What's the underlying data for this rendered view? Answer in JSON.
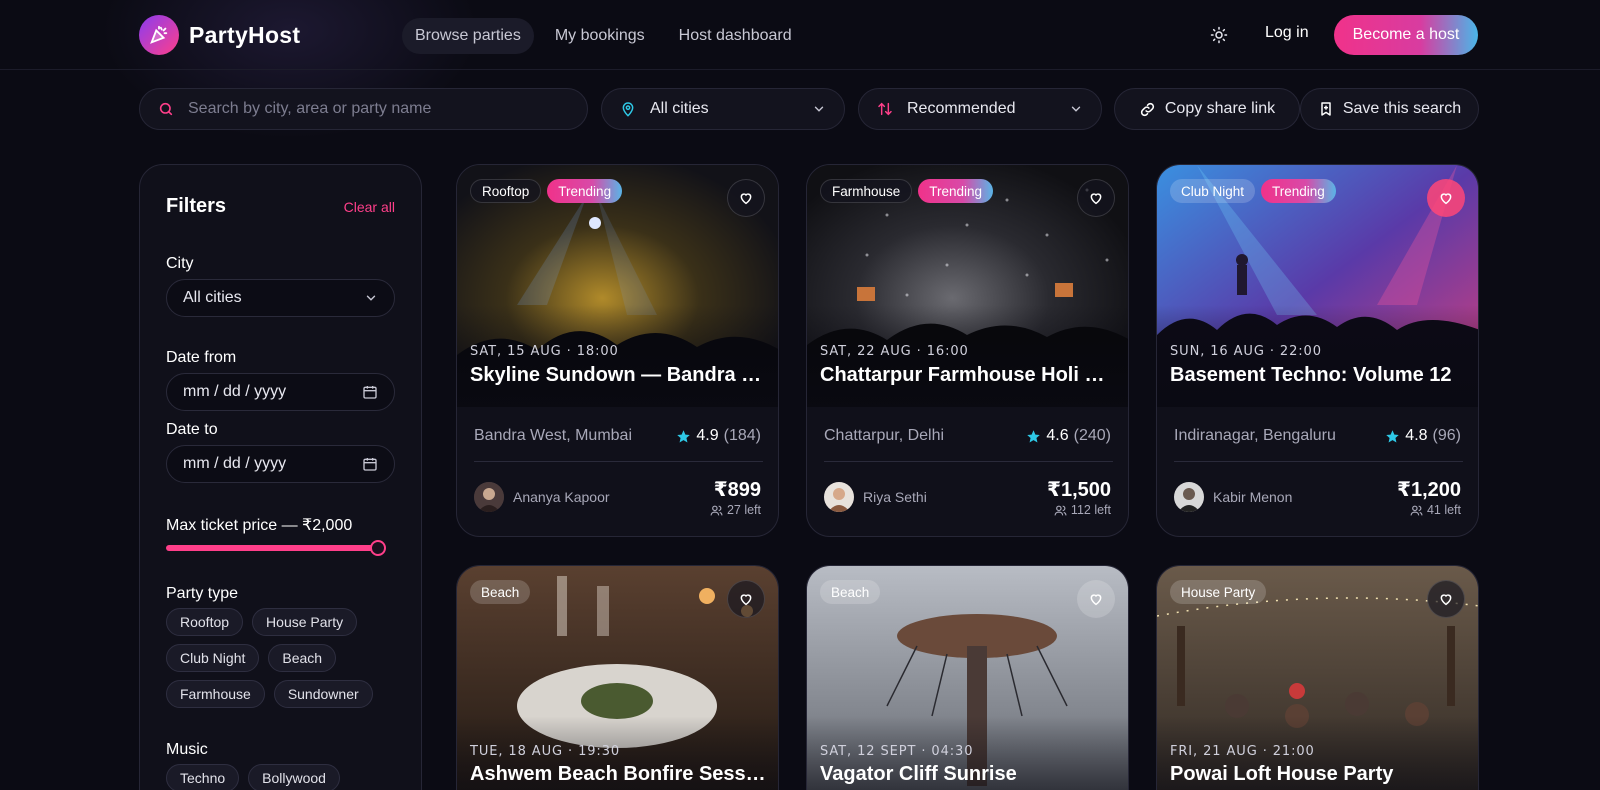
{
  "app": {
    "name": "PartyHost"
  },
  "nav": {
    "items": [
      {
        "label": "Browse parties",
        "active": true
      },
      {
        "label": "My bookings",
        "active": false
      },
      {
        "label": "Host dashboard",
        "active": false
      }
    ],
    "login": "Log in",
    "become_host": "Become a host"
  },
  "search": {
    "placeholder": "Search by city, area or party name"
  },
  "toolbar": {
    "city": "All cities",
    "sort": "Recommended",
    "share": "Copy share link",
    "save": "Save this search"
  },
  "filters": {
    "title": "Filters",
    "clear": "Clear all",
    "city_label": "City",
    "city_value": "All cities",
    "date_from_label": "Date from",
    "date_from_value": "mm / dd / yyyy",
    "date_to_label": "Date to",
    "date_to_value": "mm / dd / yyyy",
    "price_label": "Max ticket price — ₹2,000",
    "price_slider_fraction": 0.96,
    "party_type_label": "Party type",
    "party_types": [
      "Rooftop",
      "House Party",
      "Club Night",
      "Beach",
      "Farmhouse",
      "Sundowner"
    ],
    "music_label": "Music",
    "music": [
      "Techno",
      "Bollywood"
    ]
  },
  "cards": [
    {
      "tags": [
        "Rooftop",
        "Trending"
      ],
      "when": "SAT, 15 AUG · 18:00",
      "name": "Skyline Sundown — Bandra Rooftop",
      "place": "Bandra West, Mumbai",
      "rating": "4.9",
      "reviews": "(184)",
      "host": "Ananya Kapoor",
      "price": "₹899",
      "left": "27 left",
      "favorited": false
    },
    {
      "tags": [
        "Farmhouse",
        "Trending"
      ],
      "when": "SAT, 22 AUG · 16:00",
      "name": "Chattarpur Farmhouse Holi Bash",
      "place": "Chattarpur, Delhi",
      "rating": "4.6",
      "reviews": "(240)",
      "host": "Riya Sethi",
      "price": "₹1,500",
      "left": "112 left",
      "favorited": false
    },
    {
      "tags": [
        "Club Night",
        "Trending"
      ],
      "when": "SUN, 16 AUG · 22:00",
      "name": "Basement Techno: Volume 12",
      "place": "Indiranagar, Bengaluru",
      "rating": "4.8",
      "reviews": "(96)",
      "host": "Kabir Menon",
      "price": "₹1,200",
      "left": "41 left",
      "favorited": true
    },
    {
      "tags": [
        "Beach"
      ],
      "when": "TUE, 18 AUG · 19:30",
      "name": "Ashwem Beach Bonfire Session",
      "favorited": false
    },
    {
      "tags": [
        "Beach"
      ],
      "when": "SAT, 12 SEPT · 04:30",
      "name": "Vagator Cliff Sunrise",
      "favorited": false
    },
    {
      "tags": [
        "House Party"
      ],
      "when": "FRI, 21 AUG · 21:00",
      "name": "Powai Loft House Party",
      "favorited": false
    }
  ],
  "icons": {
    "logo": "party-popper-icon",
    "theme": "sun-icon",
    "search": "search-icon",
    "location": "map-pin-icon",
    "sort": "sort-arrows-icon",
    "share": "link-icon",
    "save": "bookmark-icon",
    "calendar": "calendar-icon",
    "favorite": "heart-icon",
    "star": "star-icon",
    "people": "users-icon"
  },
  "colors": {
    "accent": "#ff3f8a",
    "gradient_end": "#4ab6e8",
    "star": "#2ec8e6",
    "background": "#0b0b14"
  }
}
